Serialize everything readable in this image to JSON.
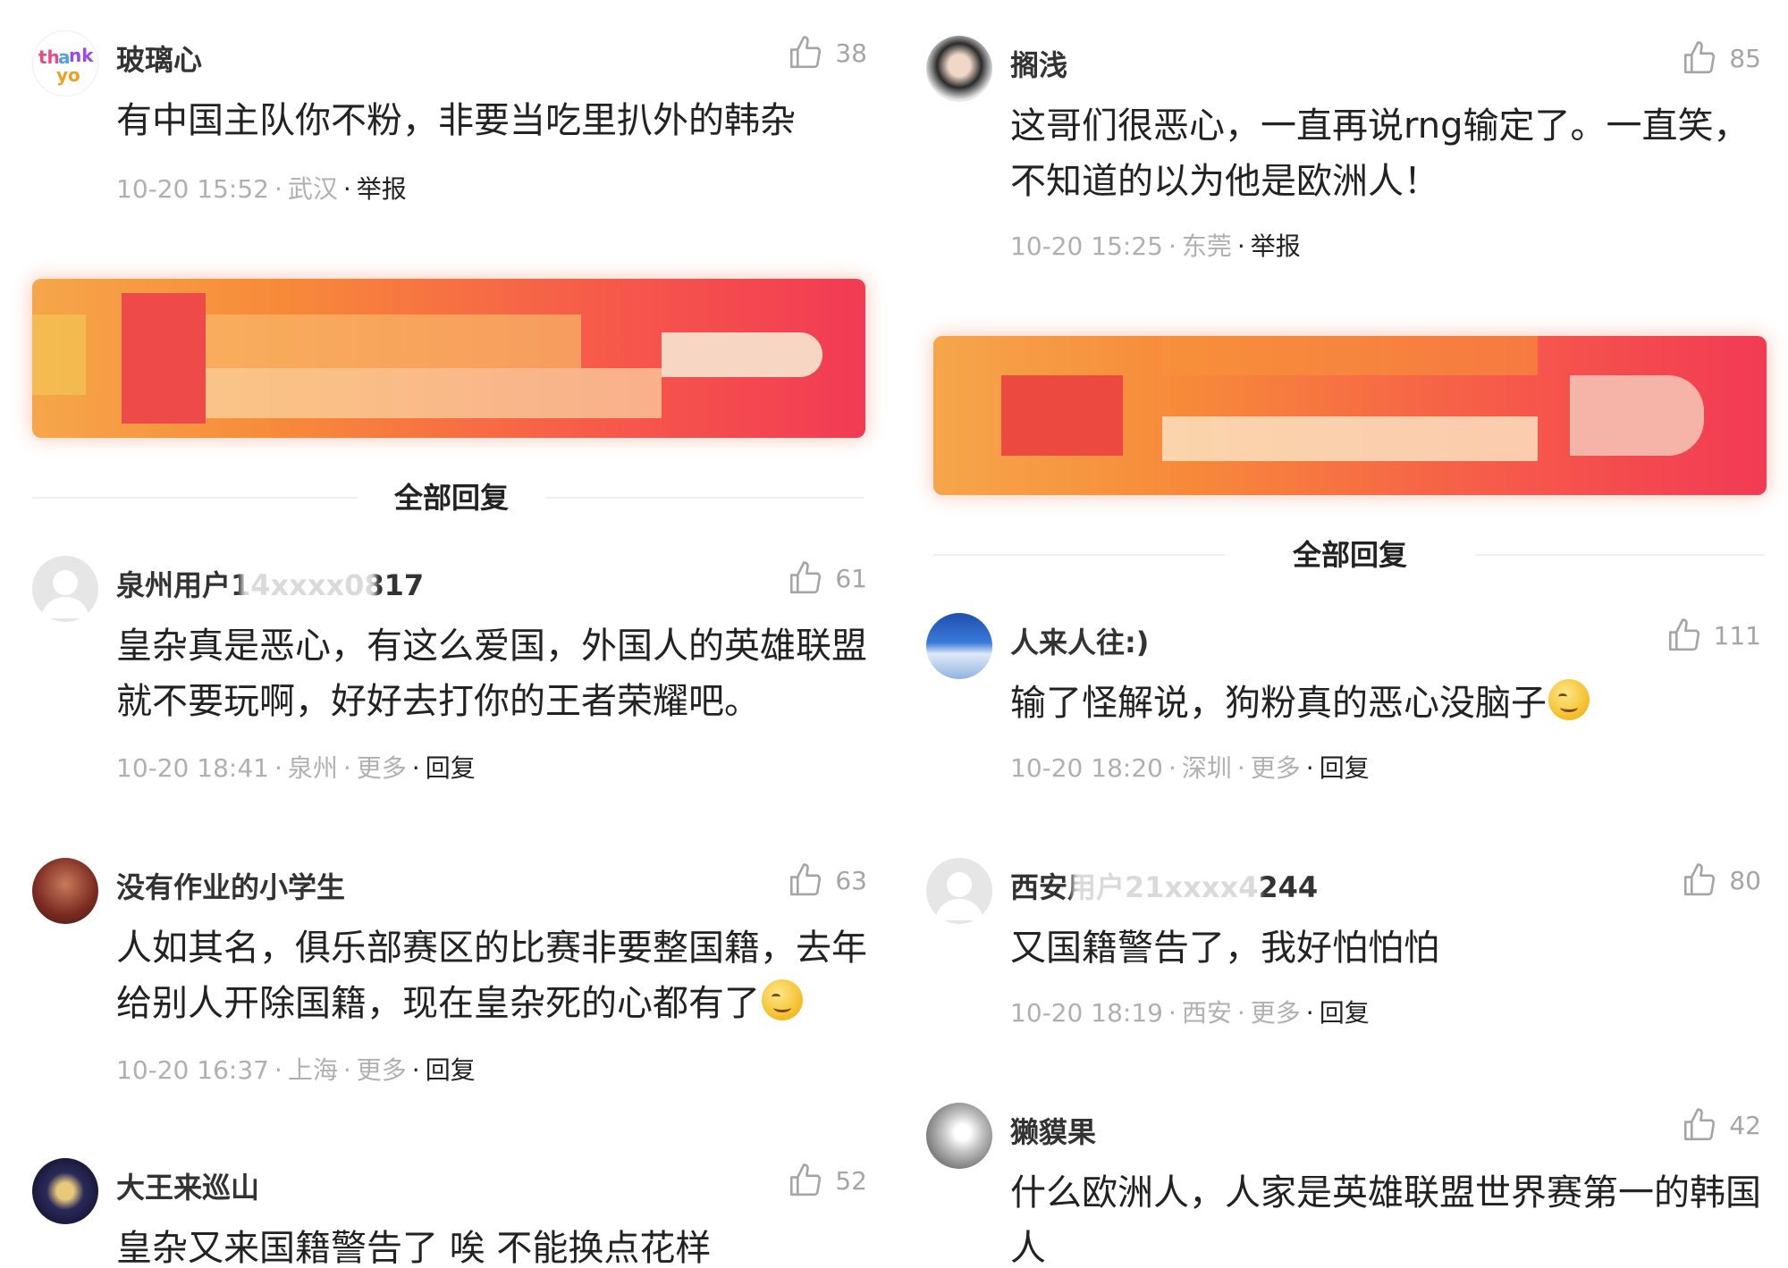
{
  "left_column": {
    "top_comment": {
      "username": "玻璃心",
      "likes": "38",
      "text": "有中国主队你不粉，非要当吃里扒外的韩杂",
      "date": "10-20 15:52",
      "location": "武汉",
      "action": "举报"
    },
    "all_replies_label": "全部回复",
    "replies": [
      {
        "username": "泉州用户14xxxx0817",
        "likes": "61",
        "text": "皇杂真是恶心，有这么爱国，外国人的英雄联盟就不要玩啊，好好去打你的王者荣耀吧。",
        "date": "10-20 18:41",
        "location": "泉州",
        "more": "更多",
        "action": "回复"
      },
      {
        "username": "没有作业的小学生",
        "likes": "63",
        "text": "人如其名，俱乐部赛区的比赛非要整国籍，去年给别人开除国籍，现在皇杂死的心都有了",
        "date": "10-20 16:37",
        "location": "上海",
        "more": "更多",
        "action": "回复"
      },
      {
        "username": "大王来巡山",
        "likes": "52",
        "text": "皇杂又来国籍警告了 唉 不能换点花样"
      }
    ]
  },
  "right_column": {
    "top_comment": {
      "username": "搁浅",
      "likes": "85",
      "text": "这哥们很恶心，一直再说rng输定了。一直笑，不知道的以为他是欧洲人！",
      "date": "10-20 15:25",
      "location": "东莞",
      "action": "举报"
    },
    "all_replies_label": "全部回复",
    "replies": [
      {
        "username": "人来人往:)",
        "likes": "111",
        "text": "输了怪解说，狗粉真的恶心没脑子",
        "date": "10-20 18:20",
        "location": "深圳",
        "more": "更多",
        "action": "回复"
      },
      {
        "username": "西安用户21xxxx4244",
        "likes": "80",
        "text": "又国籍警告了，我好怕怕怕",
        "date": "10-20 18:19",
        "location": "西安",
        "more": "更多",
        "action": "回复"
      },
      {
        "username": "獭貘果",
        "likes": "42",
        "text": "什么欧洲人，人家是英雄联盟世界赛第一的韩国人"
      }
    ]
  },
  "icons": {
    "like": "thumbs-up-icon",
    "emoji": "smirk-emoji-icon",
    "avatar_default": "default-user-avatar-icon"
  },
  "colors": {
    "meta_gray": "#b0b0b0",
    "like_gray": "#a5a5a5",
    "banner_orange": "#f78a3a",
    "banner_red": "#f23a55"
  }
}
